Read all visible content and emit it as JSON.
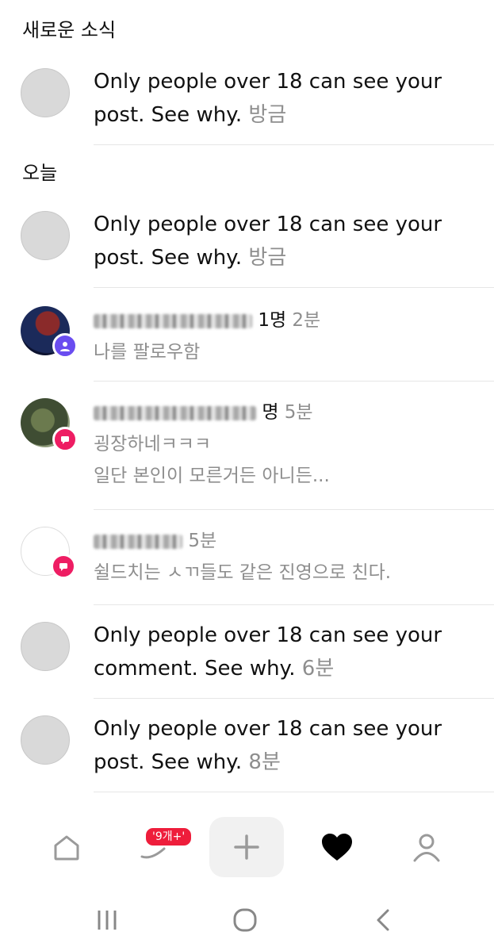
{
  "sections": {
    "new_title": "새로운 소식",
    "today_title": "오늘"
  },
  "notifications": [
    {
      "text": "Only people over 18 can see your post. See why.",
      "time": "방금"
    },
    {
      "text": "Only people over 18 can see your post. See why.",
      "time": "방금"
    },
    {
      "suffix": "1명",
      "time": "2분",
      "detail": "나를 팔로우함"
    },
    {
      "suffix": "명",
      "time": "5분",
      "detail": "굉장하네ㅋㅋㅋ",
      "detail2": "일단 본인이 모른거든 아니든..."
    },
    {
      "time": "5분",
      "detail": "쉴드치는 ㅅㄲ들도 같은 진영으로 친다."
    },
    {
      "text": "Only people over 18 can see your comment. See why.",
      "time": "6분"
    },
    {
      "text": "Only people over 18 can see your post. See why.",
      "time": "8분"
    }
  ],
  "bottom_nav": {
    "badge": "'9개+'",
    "items": [
      "home-icon",
      "send-icon",
      "plus-icon",
      "heart-icon",
      "profile-icon"
    ]
  },
  "system_nav": [
    "recents-icon",
    "home-circle-icon",
    "back-icon"
  ]
}
